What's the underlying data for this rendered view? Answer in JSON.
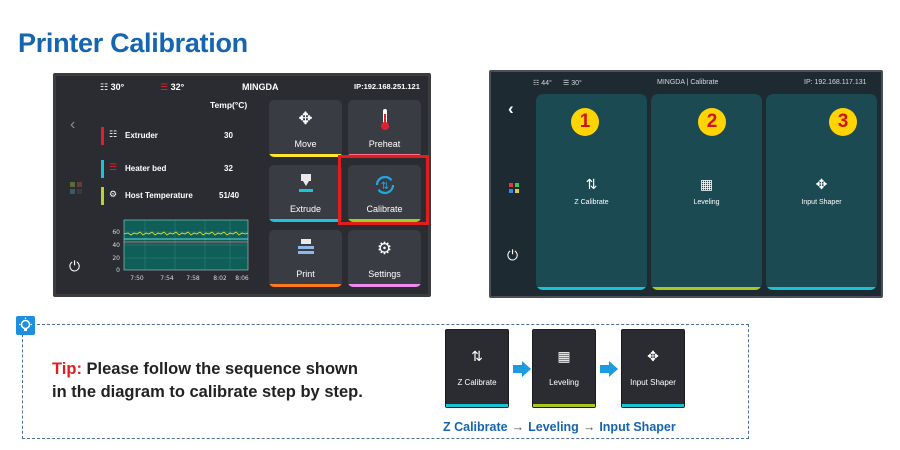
{
  "page": {
    "title": "Printer Calibration"
  },
  "screen1": {
    "status": {
      "extruder_temp": "30°",
      "bed_temp": "32°",
      "device": "MINGDA",
      "ip": "IP:192.168.251.121"
    },
    "temp_header": "Temp(°C)",
    "temps": [
      {
        "label": "Extruder",
        "value": "30",
        "color": "#e0212c",
        "icon": "extruder-icon"
      },
      {
        "label": "Heater bed",
        "value": "32",
        "color": "#19c6d6",
        "icon": "heater-bed-icon"
      },
      {
        "label": "Host Temperature",
        "value": "51/40",
        "color": "#b8d42a",
        "icon": "gear-icon"
      }
    ],
    "graph": {
      "y_ticks": [
        "60",
        "40",
        "20",
        "0"
      ],
      "x_ticks": [
        "7:50",
        "7:54",
        "7:58",
        "8:02",
        "8:06"
      ]
    },
    "tiles": [
      {
        "label": "Move",
        "color": "#ffe530"
      },
      {
        "label": "Preheat",
        "color": "#ff6f8f"
      },
      {
        "label": "Extrude",
        "color": "#1ec4dc"
      },
      {
        "label": "Calibrate",
        "color": "#9cd21c"
      },
      {
        "label": "Print",
        "color": "#ff7a1a"
      },
      {
        "label": "Settings",
        "color": "#f08aef"
      }
    ]
  },
  "screen2": {
    "status": {
      "extruder_temp": "44°",
      "bed_temp": "30°",
      "title": "MINGDA | Calibrate",
      "ip": "IP: 192.168.117.131"
    },
    "panels": [
      {
        "number": "1",
        "label": "Z Calibrate",
        "color": "#16c2d6"
      },
      {
        "number": "2",
        "label": "Leveling",
        "color": "#a8c81e"
      },
      {
        "number": "3",
        "label": "Input Shaper",
        "color": "#16c2d6"
      }
    ]
  },
  "tip": {
    "label": "Tip:",
    "text_line1": " Please follow the sequence shown",
    "text_line2": "in the diagram to calibrate step by step.",
    "steps": [
      {
        "label": "Z Calibrate",
        "color": "#16c2d6"
      },
      {
        "label": "Leveling",
        "color": "#a8c81e"
      },
      {
        "label": "Input Shaper",
        "color": "#16c2d6"
      }
    ],
    "caption": {
      "step1": "Z Calibrate",
      "step2": "Leveling",
      "step3": "Input Shaper",
      "separator": "→"
    }
  }
}
